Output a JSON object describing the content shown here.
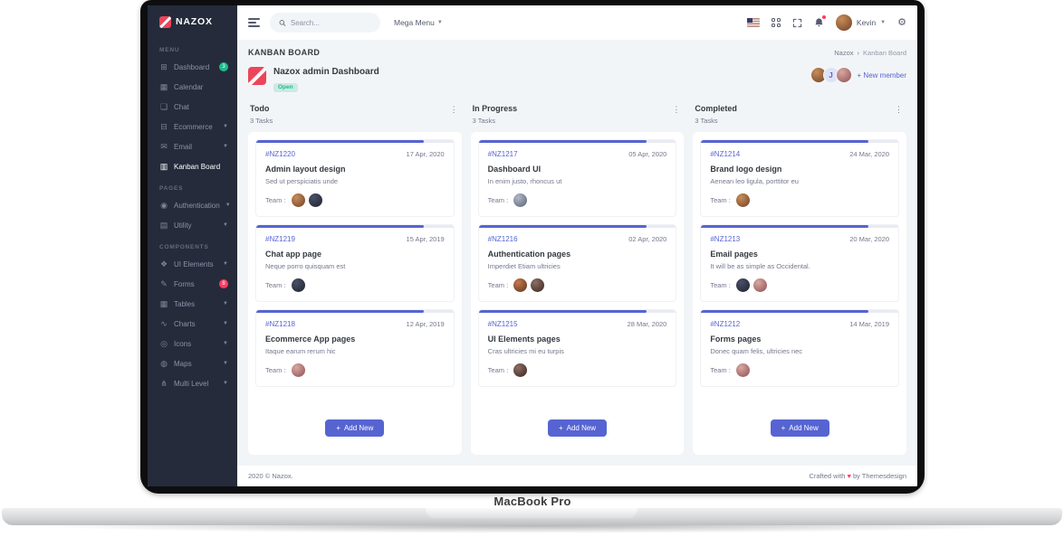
{
  "device": {
    "label": "MacBook Pro"
  },
  "colors": {
    "accent": "#5664d2",
    "success": "#1cbb8c",
    "danger": "#ff3d60",
    "sidebar_bg": "#252b3b",
    "brand_red": "#ec4559"
  },
  "sidebar": {
    "brand": "NAZOX",
    "sections": [
      {
        "label": "MENU",
        "items": [
          {
            "label": "Dashboard",
            "icon": "dashboard-icon",
            "glyph": "⊞",
            "badge": "3",
            "badge_type": "success"
          },
          {
            "label": "Calendar",
            "icon": "calendar-icon",
            "glyph": "▦"
          },
          {
            "label": "Chat",
            "icon": "chat-icon",
            "glyph": "❏"
          },
          {
            "label": "Ecommerce",
            "icon": "ecommerce-icon",
            "glyph": "⊟",
            "chevron": true
          },
          {
            "label": "Email",
            "icon": "email-icon",
            "glyph": "✉",
            "chevron": true
          },
          {
            "label": "Kanban Board",
            "icon": "kanban-icon",
            "glyph": "▥",
            "active": true
          }
        ]
      },
      {
        "label": "PAGES",
        "items": [
          {
            "label": "Authentication",
            "icon": "authentication-icon",
            "glyph": "◉",
            "chevron": true
          },
          {
            "label": "Utility",
            "icon": "utility-icon",
            "glyph": "▤",
            "chevron": true
          }
        ]
      },
      {
        "label": "COMPONENTS",
        "items": [
          {
            "label": "UI Elements",
            "icon": "ui-elements-icon",
            "glyph": "❖",
            "chevron": true
          },
          {
            "label": "Forms",
            "icon": "forms-icon",
            "glyph": "✎",
            "badge": "8",
            "badge_type": "danger"
          },
          {
            "label": "Tables",
            "icon": "tables-icon",
            "glyph": "▦",
            "chevron": true
          },
          {
            "label": "Charts",
            "icon": "charts-icon",
            "glyph": "∿",
            "chevron": true
          },
          {
            "label": "Icons",
            "icon": "icons-icon",
            "glyph": "◎",
            "chevron": true
          },
          {
            "label": "Maps",
            "icon": "maps-icon",
            "glyph": "◍",
            "chevron": true
          },
          {
            "label": "Multi Level",
            "icon": "multi-level-icon",
            "glyph": "⋔",
            "chevron": true
          }
        ]
      }
    ]
  },
  "topbar": {
    "search_placeholder": "Search...",
    "mega_menu": "Mega Menu",
    "user": "Kevin"
  },
  "page": {
    "title": "KANBAN BOARD",
    "breadcrumb": [
      "Nazox",
      "Kanban Board"
    ],
    "breadcrumb_sep": "›"
  },
  "board": {
    "title": "Nazox admin Dashboard",
    "status": "Open",
    "members": [
      {
        "type": "photo"
      },
      {
        "type": "letter",
        "letter": "J"
      },
      {
        "type": "photo"
      }
    ],
    "new_member": "+ New member",
    "team_label": "Team :",
    "add_label": "Add New",
    "add_plus": "+",
    "menu_glyph": "⋮",
    "columns": [
      {
        "title": "Todo",
        "count": "3 Tasks",
        "cards": [
          {
            "id": "#NZ1220",
            "date": "17 Apr, 2020",
            "title": "Admin layout design",
            "desc": "Sed ut perspiciatis unde",
            "team": 2
          },
          {
            "id": "#NZ1219",
            "date": "15 Apr, 2019",
            "title": "Chat app page",
            "desc": "Neque porro quisquam est",
            "team": 1
          },
          {
            "id": "#NZ1218",
            "date": "12 Apr, 2019",
            "title": "Ecommerce App pages",
            "desc": "Itaque earum rerum hic",
            "team": 1
          }
        ]
      },
      {
        "title": "In Progress",
        "count": "3 Tasks",
        "cards": [
          {
            "id": "#NZ1217",
            "date": "05 Apr, 2020",
            "title": "Dashboard UI",
            "desc": "In enim justo, rhoncus ut",
            "team": 1
          },
          {
            "id": "#NZ1216",
            "date": "02 Apr, 2020",
            "title": "Authentication pages",
            "desc": "Imperdiet Etiam ultricies",
            "team": 2
          },
          {
            "id": "#NZ1215",
            "date": "28 Mar, 2020",
            "title": "UI Elements pages",
            "desc": "Cras ultricies mi eu turpis",
            "team": 1
          }
        ]
      },
      {
        "title": "Completed",
        "count": "3 Tasks",
        "cards": [
          {
            "id": "#NZ1214",
            "date": "24 Mar, 2020",
            "title": "Brand logo design",
            "desc": "Aenean leo ligula, porttitor eu",
            "team": 1
          },
          {
            "id": "#NZ1213",
            "date": "20 Mar, 2020",
            "title": "Email pages",
            "desc": "It will be as simple as Occidental.",
            "team": 2
          },
          {
            "id": "#NZ1212",
            "date": "14 Mar, 2019",
            "title": "Forms pages",
            "desc": "Donec quam felis, ultricies nec",
            "team": 1
          }
        ]
      }
    ]
  },
  "footer": {
    "left": "2020 © Nazox.",
    "right_prefix": "Crafted with",
    "heart": "♥",
    "right_suffix": "by Themesdesign"
  }
}
